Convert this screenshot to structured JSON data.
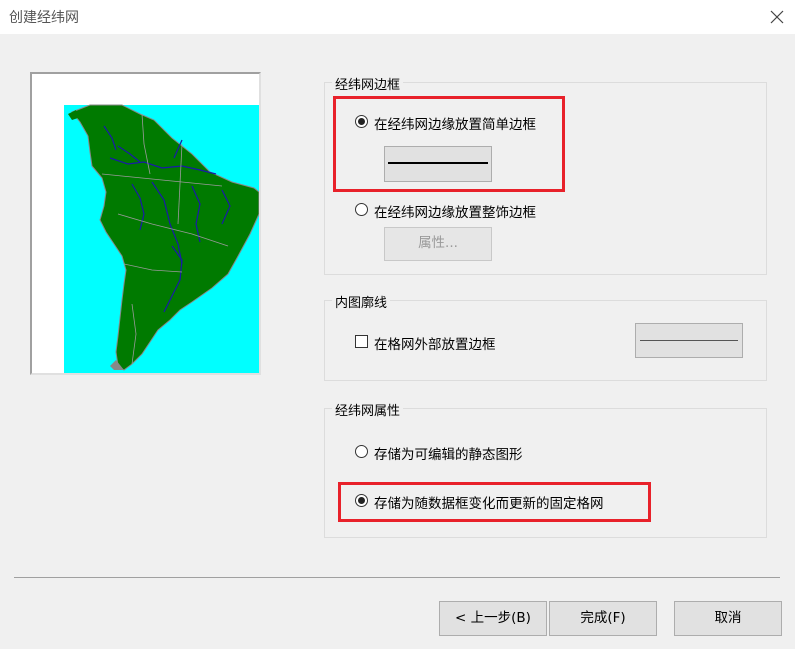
{
  "window": {
    "title": "创建经纬网"
  },
  "border_group": {
    "label": "经纬网边框",
    "simple_option": "在经纬网边缘放置简单边框",
    "fancy_option": "在经纬网边缘放置整饰边框",
    "properties_button": "属性..."
  },
  "neatline_group": {
    "label": "内图廓线",
    "option": "在格网外部放置边框"
  },
  "props_group": {
    "label": "经纬网属性",
    "static_option": "存储为可编辑的静态图形",
    "fixed_option": "存储为随数据框变化而更新的固定格网"
  },
  "buttons": {
    "back": "< 上一步(B)",
    "finish": "完成(F)",
    "cancel": "取消"
  },
  "colors": {
    "ocean": "#00ffff",
    "land": "#007a00",
    "river": "#1a1aa8",
    "highlight": "#e8212a"
  }
}
